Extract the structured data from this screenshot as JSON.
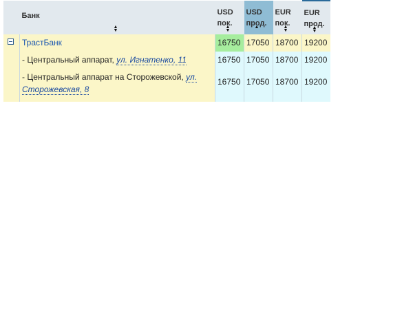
{
  "header": {
    "bank_label": "Банк",
    "columns": [
      {
        "line1": "USD",
        "line2": "пок."
      },
      {
        "line1": "USD",
        "line2": "прод."
      },
      {
        "line1": "EUR",
        "line2": "пок."
      },
      {
        "line1": "EUR",
        "line2": "прод."
      }
    ]
  },
  "bank": {
    "name": "ТрастБанк",
    "rates": [
      "16750",
      "17050",
      "18700",
      "19200"
    ],
    "branches": [
      {
        "prefix": "- Центральный аппарат, ",
        "address": "ул. Игнатенко, 11",
        "rates": [
          "16750",
          "17050",
          "18700",
          "19200"
        ]
      },
      {
        "prefix": "- Центральный аппарат на Сторожевской, ",
        "address": "ул. Сторожевская, 8",
        "rates": [
          "16750",
          "17050",
          "18700",
          "19200"
        ]
      }
    ]
  },
  "colors": {
    "header_bg": "#e2e9ee",
    "active_sort_bg": "#8fbcd4",
    "row_bg": "#fbf6c8",
    "rate_bg": "#dff9fd",
    "best_rate_bg": "#a6ed9e",
    "link": "#1a56b0"
  }
}
